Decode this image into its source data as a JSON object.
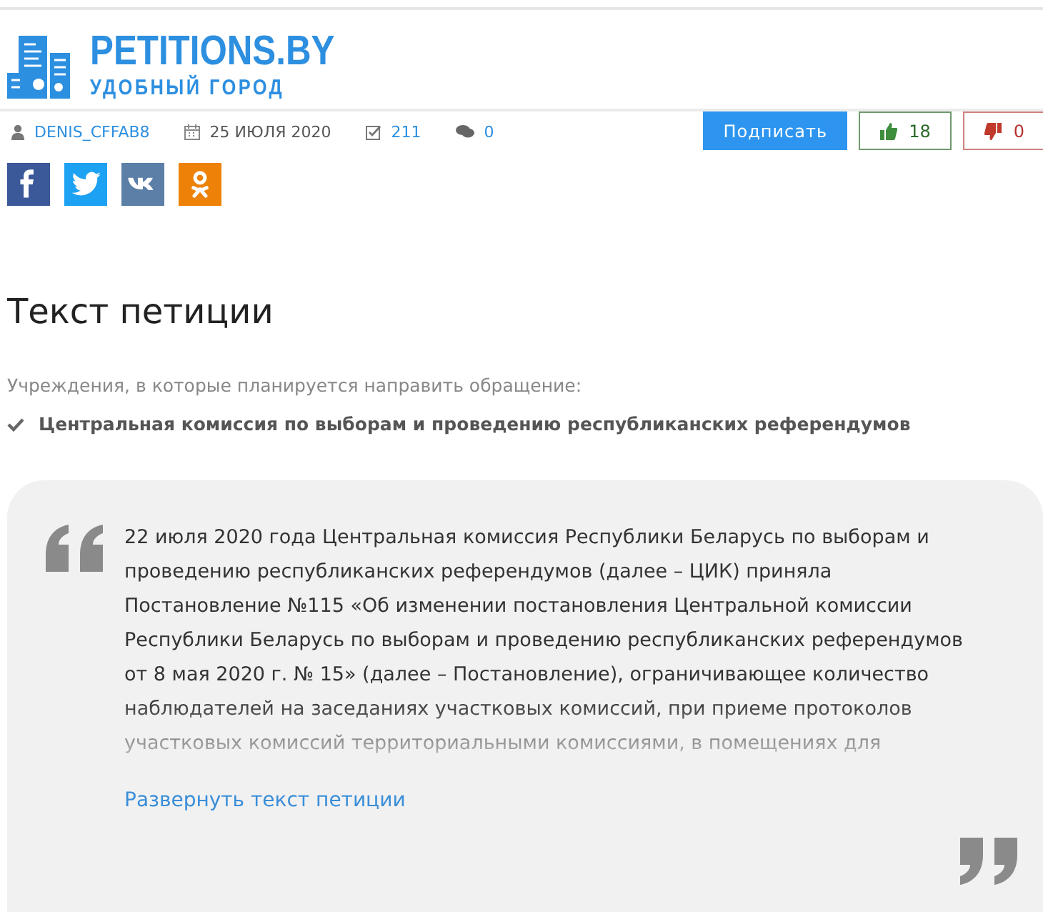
{
  "logo": {
    "title": "PETITIONS.BY",
    "subtitle": "УДОБНЫЙ ГОРОД"
  },
  "meta": {
    "author": "DENIS_CFFAB8",
    "date": "25 ИЮЛЯ 2020",
    "signatures": "211",
    "comments": "0"
  },
  "actions": {
    "sign": "Подписать",
    "likes": "18",
    "dislikes": "0"
  },
  "share": [
    {
      "kind": "facebook"
    },
    {
      "kind": "twitter"
    },
    {
      "kind": "vk"
    },
    {
      "kind": "ok"
    }
  ],
  "heading": "Текст петиции",
  "recipients_label": "Учреждения, в которые планируется направить обращение:",
  "recipients": [
    "Центральная комиссия по выборам и проведению республиканских референдумов"
  ],
  "petition": {
    "lines": [
      "22 июля 2020 года Центральная комиссия Республики Беларусь по выборам и",
      "проведению республиканских референдумов (далее – ЦИК) приняла",
      "Постановление №115 «Об изменении постановления Центральной комиссии",
      "Республики Беларусь по выборам и проведению республиканских референдумов",
      "от 8 мая 2020 г. № 15» (далее – Постановление), ограничивающее количество",
      "наблюдателей на заседаниях участковых комиссий, при приеме протоколов",
      "участковых комиссий территориальными комиссиями, в помещениях для"
    ],
    "expand_link": "Развернуть текст петиции"
  }
}
